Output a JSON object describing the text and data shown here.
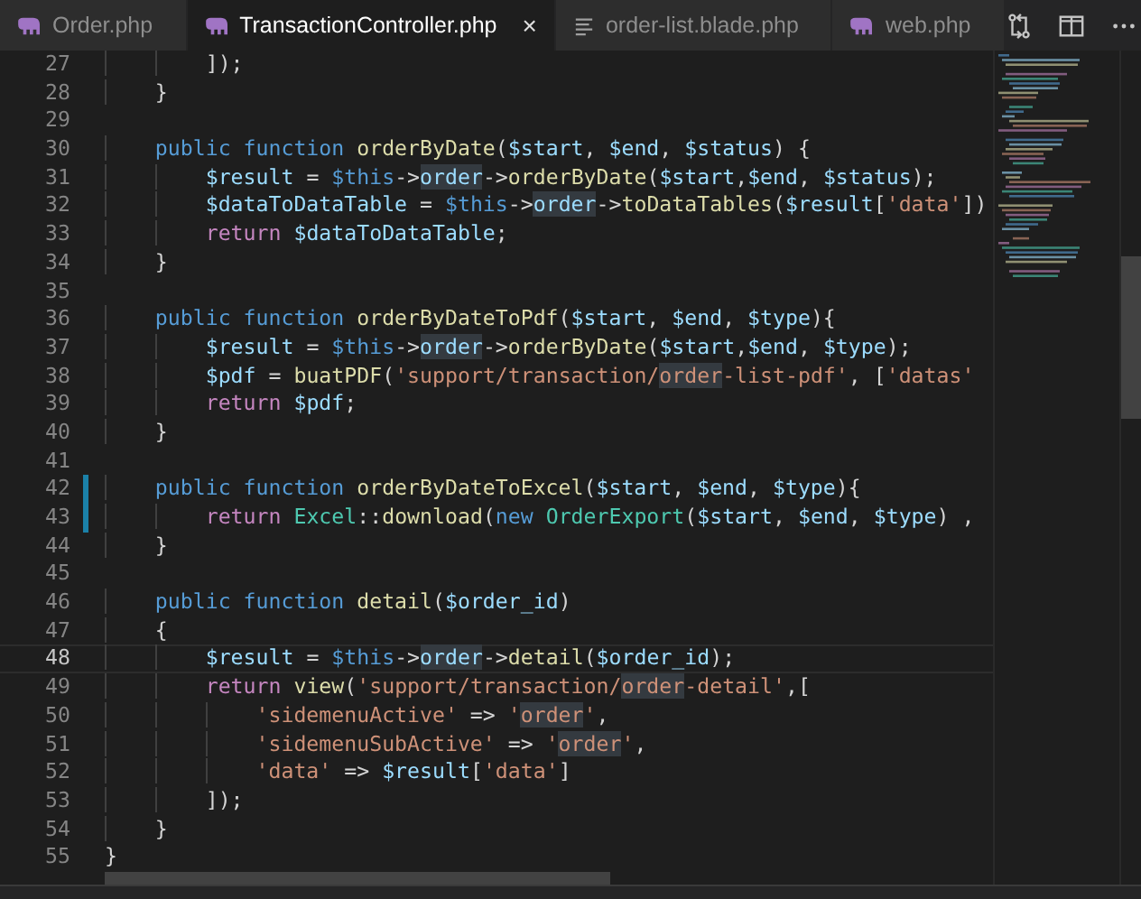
{
  "tabs": [
    {
      "label": "Order.php",
      "kind": "php",
      "selected": false
    },
    {
      "label": "TransactionController.php",
      "kind": "php",
      "selected": true,
      "close": "×"
    },
    {
      "label": "order-list.blade.php",
      "kind": "text",
      "selected": false
    },
    {
      "label": "web.php",
      "kind": "php",
      "selected": false
    }
  ],
  "editor": {
    "lines": [
      {
        "number": "27",
        "modified": false,
        "current": false,
        "tokens": [
          {
            "kind": "punct",
            "text": "        ]);"
          }
        ]
      },
      {
        "number": "28",
        "modified": false,
        "current": false,
        "tokens": [
          {
            "kind": "punct",
            "text": "    }"
          }
        ]
      },
      {
        "number": "29",
        "modified": false,
        "current": false
      },
      {
        "number": "30",
        "modified": false,
        "current": false,
        "tokens": [
          {
            "kind": "keyword",
            "text": "    public function "
          },
          {
            "kind": "function",
            "text": "orderByDate"
          },
          {
            "kind": "punct",
            "text": "("
          },
          {
            "kind": "variable",
            "text": "$start"
          },
          {
            "kind": "punct",
            "text": ", "
          },
          {
            "kind": "variable",
            "text": "$end"
          },
          {
            "kind": "punct",
            "text": ", "
          },
          {
            "kind": "variable",
            "text": "$status"
          },
          {
            "kind": "punct",
            "text": ") {"
          }
        ]
      },
      {
        "number": "31",
        "modified": false,
        "current": false,
        "tokens": [
          {
            "kind": "variable",
            "text": "        $result"
          },
          {
            "kind": "punct",
            "text": " = "
          },
          {
            "kind": "keyword",
            "text": "$this"
          },
          {
            "kind": "punct",
            "text": "->"
          },
          {
            "kind": "variable",
            "text": "order",
            "match": true
          },
          {
            "kind": "punct",
            "text": "->"
          },
          {
            "kind": "function",
            "text": "orderByDate"
          },
          {
            "kind": "punct",
            "text": "("
          },
          {
            "kind": "variable",
            "text": "$start"
          },
          {
            "kind": "punct",
            "text": ","
          },
          {
            "kind": "variable",
            "text": "$end"
          },
          {
            "kind": "punct",
            "text": ", "
          },
          {
            "kind": "variable",
            "text": "$status"
          },
          {
            "kind": "punct",
            "text": ");"
          }
        ]
      },
      {
        "number": "32",
        "modified": false,
        "current": false,
        "tokens": [
          {
            "kind": "variable",
            "text": "        $dataToDataTable"
          },
          {
            "kind": "punct",
            "text": " = "
          },
          {
            "kind": "keyword",
            "text": "$this"
          },
          {
            "kind": "punct",
            "text": "->"
          },
          {
            "kind": "variable",
            "text": "order",
            "match": true
          },
          {
            "kind": "punct",
            "text": "->"
          },
          {
            "kind": "function",
            "text": "toDataTables"
          },
          {
            "kind": "punct",
            "text": "("
          },
          {
            "kind": "variable",
            "text": "$result"
          },
          {
            "kind": "punct",
            "text": "["
          },
          {
            "kind": "string",
            "text": "'data'"
          },
          {
            "kind": "punct",
            "text": "])"
          }
        ]
      },
      {
        "number": "33",
        "modified": false,
        "current": false,
        "tokens": [
          {
            "kind": "control",
            "text": "        return "
          },
          {
            "kind": "variable",
            "text": "$dataToDataTable"
          },
          {
            "kind": "punct",
            "text": ";"
          }
        ]
      },
      {
        "number": "34",
        "modified": false,
        "current": false,
        "tokens": [
          {
            "kind": "punct",
            "text": "    }"
          }
        ]
      },
      {
        "number": "35",
        "modified": false,
        "current": false
      },
      {
        "number": "36",
        "modified": false,
        "current": false,
        "tokens": [
          {
            "kind": "keyword",
            "text": "    public function "
          },
          {
            "kind": "function",
            "text": "orderByDateToPdf"
          },
          {
            "kind": "punct",
            "text": "("
          },
          {
            "kind": "variable",
            "text": "$start"
          },
          {
            "kind": "punct",
            "text": ", "
          },
          {
            "kind": "variable",
            "text": "$end"
          },
          {
            "kind": "punct",
            "text": ", "
          },
          {
            "kind": "variable",
            "text": "$type"
          },
          {
            "kind": "punct",
            "text": "){"
          }
        ]
      },
      {
        "number": "37",
        "modified": false,
        "current": false,
        "tokens": [
          {
            "kind": "variable",
            "text": "        $result"
          },
          {
            "kind": "punct",
            "text": " = "
          },
          {
            "kind": "keyword",
            "text": "$this"
          },
          {
            "kind": "punct",
            "text": "->"
          },
          {
            "kind": "variable",
            "text": "order",
            "match": true
          },
          {
            "kind": "punct",
            "text": "->"
          },
          {
            "kind": "function",
            "text": "orderByDate"
          },
          {
            "kind": "punct",
            "text": "("
          },
          {
            "kind": "variable",
            "text": "$start"
          },
          {
            "kind": "punct",
            "text": ","
          },
          {
            "kind": "variable",
            "text": "$end"
          },
          {
            "kind": "punct",
            "text": ", "
          },
          {
            "kind": "variable",
            "text": "$type"
          },
          {
            "kind": "punct",
            "text": ");"
          }
        ]
      },
      {
        "number": "38",
        "modified": false,
        "current": false,
        "tokens": [
          {
            "kind": "variable",
            "text": "        $pdf"
          },
          {
            "kind": "punct",
            "text": " = "
          },
          {
            "kind": "function",
            "text": "buatPDF"
          },
          {
            "kind": "punct",
            "text": "("
          },
          {
            "kind": "string",
            "text": "'support/transaction/"
          },
          {
            "kind": "string",
            "text": "order",
            "match": true
          },
          {
            "kind": "string",
            "text": "-list-pdf'"
          },
          {
            "kind": "punct",
            "text": ", ["
          },
          {
            "kind": "string",
            "text": "'datas'"
          }
        ]
      },
      {
        "number": "39",
        "modified": false,
        "current": false,
        "tokens": [
          {
            "kind": "control",
            "text": "        return "
          },
          {
            "kind": "variable",
            "text": "$pdf"
          },
          {
            "kind": "punct",
            "text": ";"
          }
        ]
      },
      {
        "number": "40",
        "modified": false,
        "current": false,
        "tokens": [
          {
            "kind": "punct",
            "text": "    }"
          }
        ]
      },
      {
        "number": "41",
        "modified": false,
        "current": false
      },
      {
        "number": "42",
        "modified": true,
        "current": false,
        "tokens": [
          {
            "kind": "keyword",
            "text": "    public function "
          },
          {
            "kind": "function",
            "text": "orderByDateToExcel"
          },
          {
            "kind": "punct",
            "text": "("
          },
          {
            "kind": "variable",
            "text": "$start"
          },
          {
            "kind": "punct",
            "text": ", "
          },
          {
            "kind": "variable",
            "text": "$end"
          },
          {
            "kind": "punct",
            "text": ", "
          },
          {
            "kind": "variable",
            "text": "$type"
          },
          {
            "kind": "punct",
            "text": "){"
          }
        ]
      },
      {
        "number": "43",
        "modified": true,
        "current": false,
        "tokens": [
          {
            "kind": "control",
            "text": "        return "
          },
          {
            "kind": "class",
            "text": "Excel"
          },
          {
            "kind": "punct",
            "text": "::"
          },
          {
            "kind": "function",
            "text": "download"
          },
          {
            "kind": "punct",
            "text": "("
          },
          {
            "kind": "keyword",
            "text": "new "
          },
          {
            "kind": "class",
            "text": "OrderExport"
          },
          {
            "kind": "punct",
            "text": "("
          },
          {
            "kind": "variable",
            "text": "$start"
          },
          {
            "kind": "punct",
            "text": ", "
          },
          {
            "kind": "variable",
            "text": "$end"
          },
          {
            "kind": "punct",
            "text": ", "
          },
          {
            "kind": "variable",
            "text": "$type"
          },
          {
            "kind": "punct",
            "text": ") ,"
          }
        ]
      },
      {
        "number": "44",
        "modified": false,
        "current": false,
        "tokens": [
          {
            "kind": "punct",
            "text": "    }"
          }
        ]
      },
      {
        "number": "45",
        "modified": false,
        "current": false
      },
      {
        "number": "46",
        "modified": false,
        "current": false,
        "tokens": [
          {
            "kind": "keyword",
            "text": "    public function "
          },
          {
            "kind": "function",
            "text": "detail"
          },
          {
            "kind": "punct",
            "text": "("
          },
          {
            "kind": "variable",
            "text": "$order_id"
          },
          {
            "kind": "punct",
            "text": ")"
          }
        ]
      },
      {
        "number": "47",
        "modified": false,
        "current": false,
        "tokens": [
          {
            "kind": "punct",
            "text": "    {"
          }
        ]
      },
      {
        "number": "48",
        "modified": false,
        "current": true,
        "tokens": [
          {
            "kind": "variable",
            "text": "        $result"
          },
          {
            "kind": "punct",
            "text": " = "
          },
          {
            "kind": "keyword",
            "text": "$this"
          },
          {
            "kind": "punct",
            "text": "->"
          },
          {
            "kind": "variable",
            "text": "order",
            "match": true
          },
          {
            "kind": "punct",
            "text": "->"
          },
          {
            "kind": "function",
            "text": "detail"
          },
          {
            "kind": "punct",
            "text": "("
          },
          {
            "kind": "variable",
            "text": "$order_id"
          },
          {
            "kind": "punct",
            "text": ");"
          }
        ]
      },
      {
        "number": "49",
        "modified": false,
        "current": false,
        "tokens": [
          {
            "kind": "control",
            "text": "        return "
          },
          {
            "kind": "function",
            "text": "view"
          },
          {
            "kind": "punct",
            "text": "("
          },
          {
            "kind": "string",
            "text": "'support/transaction/"
          },
          {
            "kind": "string",
            "text": "order",
            "match": true
          },
          {
            "kind": "string",
            "text": "-detail'"
          },
          {
            "kind": "punct",
            "text": ",["
          }
        ]
      },
      {
        "number": "50",
        "modified": false,
        "current": false,
        "tokens": [
          {
            "kind": "string",
            "text": "            'sidemenuActive'"
          },
          {
            "kind": "punct",
            "text": " => "
          },
          {
            "kind": "string",
            "text": "'"
          },
          {
            "kind": "string",
            "text": "order",
            "match": true
          },
          {
            "kind": "string",
            "text": "'"
          },
          {
            "kind": "punct",
            "text": ","
          }
        ]
      },
      {
        "number": "51",
        "modified": false,
        "current": false,
        "tokens": [
          {
            "kind": "string",
            "text": "            'sidemenuSubActive'"
          },
          {
            "kind": "punct",
            "text": " => "
          },
          {
            "kind": "string",
            "text": "'"
          },
          {
            "kind": "string",
            "text": "order",
            "match": true
          },
          {
            "kind": "string",
            "text": "'"
          },
          {
            "kind": "punct",
            "text": ","
          }
        ]
      },
      {
        "number": "52",
        "modified": false,
        "current": false,
        "tokens": [
          {
            "kind": "string",
            "text": "            'data'"
          },
          {
            "kind": "punct",
            "text": " => "
          },
          {
            "kind": "variable",
            "text": "$result"
          },
          {
            "kind": "punct",
            "text": "["
          },
          {
            "kind": "string",
            "text": "'data'"
          },
          {
            "kind": "punct",
            "text": "]"
          }
        ]
      },
      {
        "number": "53",
        "modified": false,
        "current": false,
        "tokens": [
          {
            "kind": "punct",
            "text": "        ]);"
          }
        ]
      },
      {
        "number": "54",
        "modified": false,
        "current": false,
        "tokens": [
          {
            "kind": "punct",
            "text": "    }"
          }
        ]
      },
      {
        "number": "55",
        "modified": false,
        "current": false,
        "tokens": [
          {
            "kind": "punct",
            "text": "}"
          }
        ]
      }
    ]
  }
}
